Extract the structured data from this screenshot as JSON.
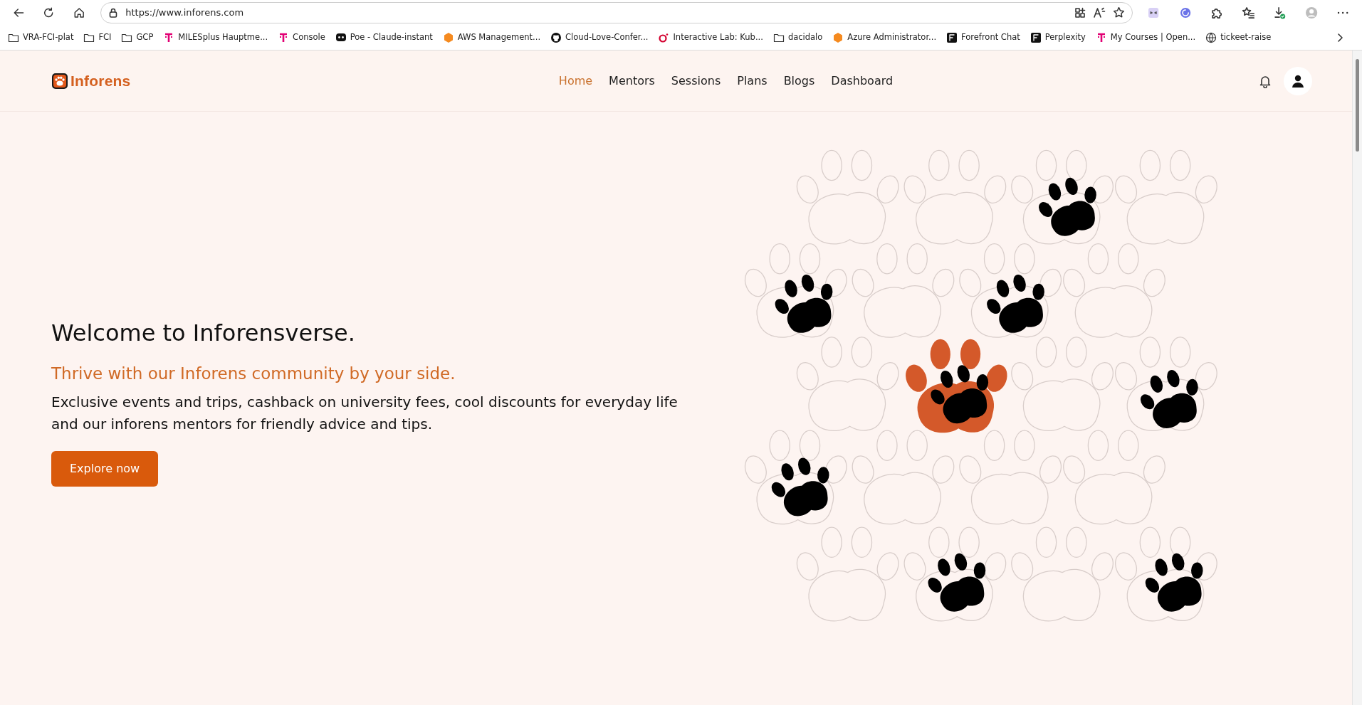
{
  "browser": {
    "url": "https://www.inforens.com",
    "bookmarks": [
      {
        "kind": "folder",
        "label": "VRA-FCI-plat"
      },
      {
        "kind": "folder",
        "label": "FCI"
      },
      {
        "kind": "folder",
        "label": "GCP"
      },
      {
        "kind": "t",
        "label": "MILESplus Hauptme..."
      },
      {
        "kind": "t",
        "label": "Console"
      },
      {
        "kind": "chat",
        "label": "Poe - Claude-instant"
      },
      {
        "kind": "hexagon",
        "label": "AWS Management..."
      },
      {
        "kind": "cat",
        "label": "Cloud-Love-Confer..."
      },
      {
        "kind": "ring",
        "label": "Interactive Lab: Kub..."
      },
      {
        "kind": "folder",
        "label": "dacidalo"
      },
      {
        "kind": "hexagon",
        "label": "Azure Administrator..."
      },
      {
        "kind": "square",
        "label": "Forefront Chat"
      },
      {
        "kind": "square",
        "label": "Perplexity"
      },
      {
        "kind": "t",
        "label": "My Courses | Open..."
      },
      {
        "kind": "globe",
        "label": "tickeet-raise"
      }
    ]
  },
  "navbar": {
    "brand": "Inforens",
    "links": [
      {
        "label": "Home",
        "selected": true
      },
      {
        "label": "Mentors",
        "selected": false
      },
      {
        "label": "Sessions",
        "selected": false
      },
      {
        "label": "Plans",
        "selected": false
      },
      {
        "label": "Blogs",
        "selected": false
      },
      {
        "label": "Dashboard",
        "selected": false
      }
    ]
  },
  "hero": {
    "title": "Welcome to Inforensverse.",
    "subtitle": "Thrive with our Inforens community by your side.",
    "body": "Exclusive events and trips, cashback on university fees, cool discounts for everyday life and our inforens mentors for friendly advice and tips.",
    "button": "Explore now"
  }
}
